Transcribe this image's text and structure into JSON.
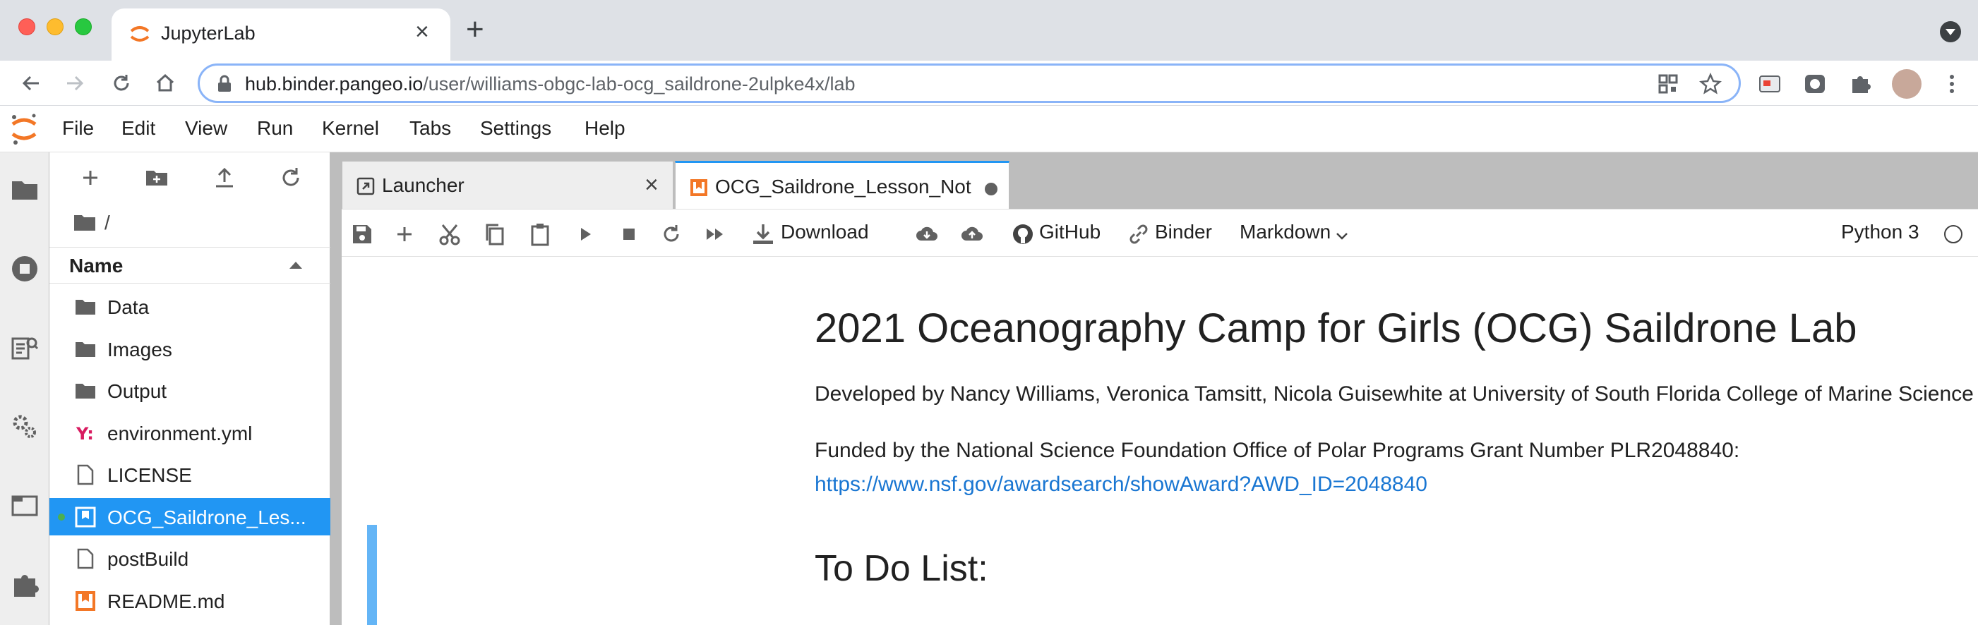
{
  "browser": {
    "tab_title": "JupyterLab",
    "url_host": "hub.binder.pangeo.io",
    "url_path": "/user/williams-obgc-lab-ocg_saildrone-2ulpke4x/lab"
  },
  "menubar": {
    "items": [
      "File",
      "Edit",
      "View",
      "Run",
      "Kernel",
      "Tabs",
      "Settings",
      "Help"
    ]
  },
  "filebrowser": {
    "breadcrumb": "/",
    "header": "Name",
    "files": [
      {
        "name": "Data",
        "icon": "folder-icon"
      },
      {
        "name": "Images",
        "icon": "folder-icon"
      },
      {
        "name": "Output",
        "icon": "folder-icon"
      },
      {
        "name": "environment.yml",
        "icon": "yaml-icon"
      },
      {
        "name": "LICENSE",
        "icon": "file-icon"
      },
      {
        "name": "OCG_Saildrone_Les...",
        "icon": "notebook-icon",
        "selected": true,
        "running": true
      },
      {
        "name": "postBuild",
        "icon": "file-icon"
      },
      {
        "name": "README.md",
        "icon": "markdown-icon"
      }
    ]
  },
  "tabs": {
    "launcher": "Launcher",
    "notebook": "OCG_Saildrone_Lesson_Not"
  },
  "nb_toolbar": {
    "download": "Download",
    "github": "GitHub",
    "binder": "Binder",
    "cell_type": "Markdown",
    "kernel": "Python 3"
  },
  "notebook": {
    "title": "2021 Oceanography Camp for Girls (OCG) Saildrone Lab",
    "developed_by": "Developed by Nancy Williams, Veronica Tamsitt, Nicola Guisewhite at University of South Florida College of Marine Science",
    "funded_by": "Funded by the National Science Foundation Office of Polar Programs Grant Number PLR2048840:",
    "link": "https://www.nsf.gov/awardsearch/showAward?AWD_ID=2048840",
    "todo_heading": "To Do List:"
  },
  "colors": {
    "accent": "#2196f3",
    "jupyter_orange": "#f37726",
    "link": "#1976d2"
  }
}
